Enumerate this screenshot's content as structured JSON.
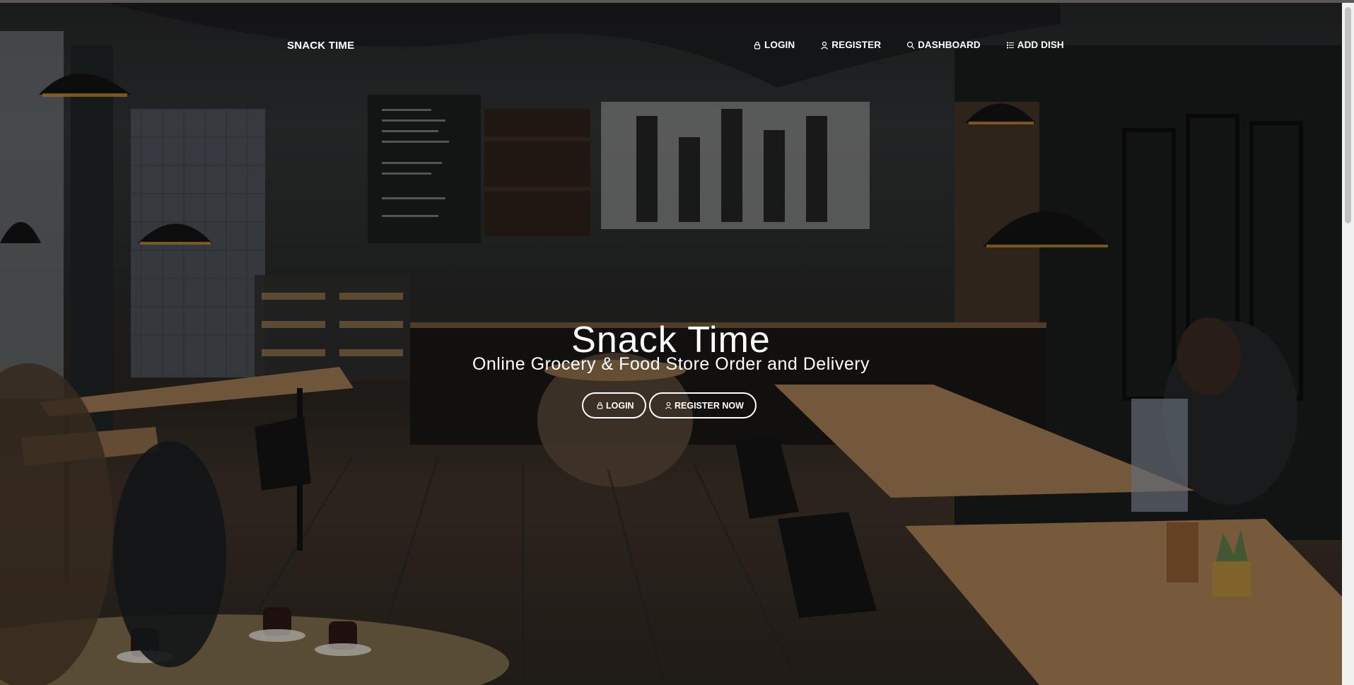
{
  "brand": {
    "name": "SNACK TIME"
  },
  "nav": {
    "login": "LOGIN",
    "register": "REGISTER",
    "dashboard": "DASHBOARD",
    "add_dish": "ADD DISH"
  },
  "hero": {
    "title": "Snack Time",
    "subtitle": "Online Grocery & Food Store Order and Delivery",
    "login_button": "LOGIN",
    "register_button": "REGISTER NOW"
  },
  "icons": {
    "login": "lock-icon",
    "register": "user-icon",
    "dashboard": "search-icon",
    "add_dish": "list-icon"
  },
  "colors": {
    "text": "#ffffff",
    "scrollbar_track": "#f1f1f1",
    "scrollbar_thumb": "#c1c1c1"
  }
}
